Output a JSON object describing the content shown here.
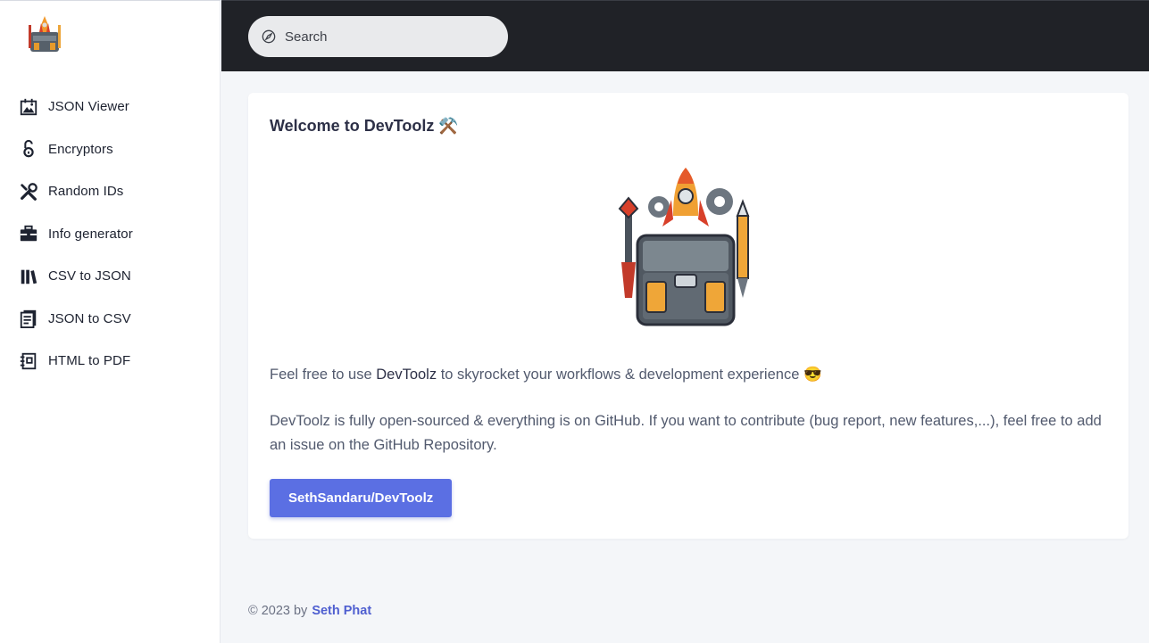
{
  "sidebar": {
    "items": [
      {
        "label": "JSON Viewer",
        "icon": "image-frame-icon"
      },
      {
        "label": "Encryptors",
        "icon": "lock-open-icon"
      },
      {
        "label": "Random IDs",
        "icon": "tools-icon"
      },
      {
        "label": "Info generator",
        "icon": "briefcase-icon"
      },
      {
        "label": "CSV to JSON",
        "icon": "books-icon"
      },
      {
        "label": "JSON to CSV",
        "icon": "document-icon"
      },
      {
        "label": "HTML to PDF",
        "icon": "notebook-icon"
      }
    ]
  },
  "topbar": {
    "search_placeholder": "Search",
    "background": "#202227"
  },
  "main": {
    "title": "Welcome to DevToolz ⚒️",
    "intro_prefix": "Feel free to use ",
    "intro_brand": "DevToolz",
    "intro_suffix": " to skyrocket your workflows & development experience 😎",
    "description": "DevToolz is fully open-sourced & everything is on GitHub. If you want to contribute (bug report, new features,...), feel free to add an issue on the GitHub Repository.",
    "repo_button": "SethSandaru/DevToolz",
    "accent": "#5b6fe3"
  },
  "footer": {
    "text": "© 2023 by",
    "author": "Seth Phat"
  }
}
